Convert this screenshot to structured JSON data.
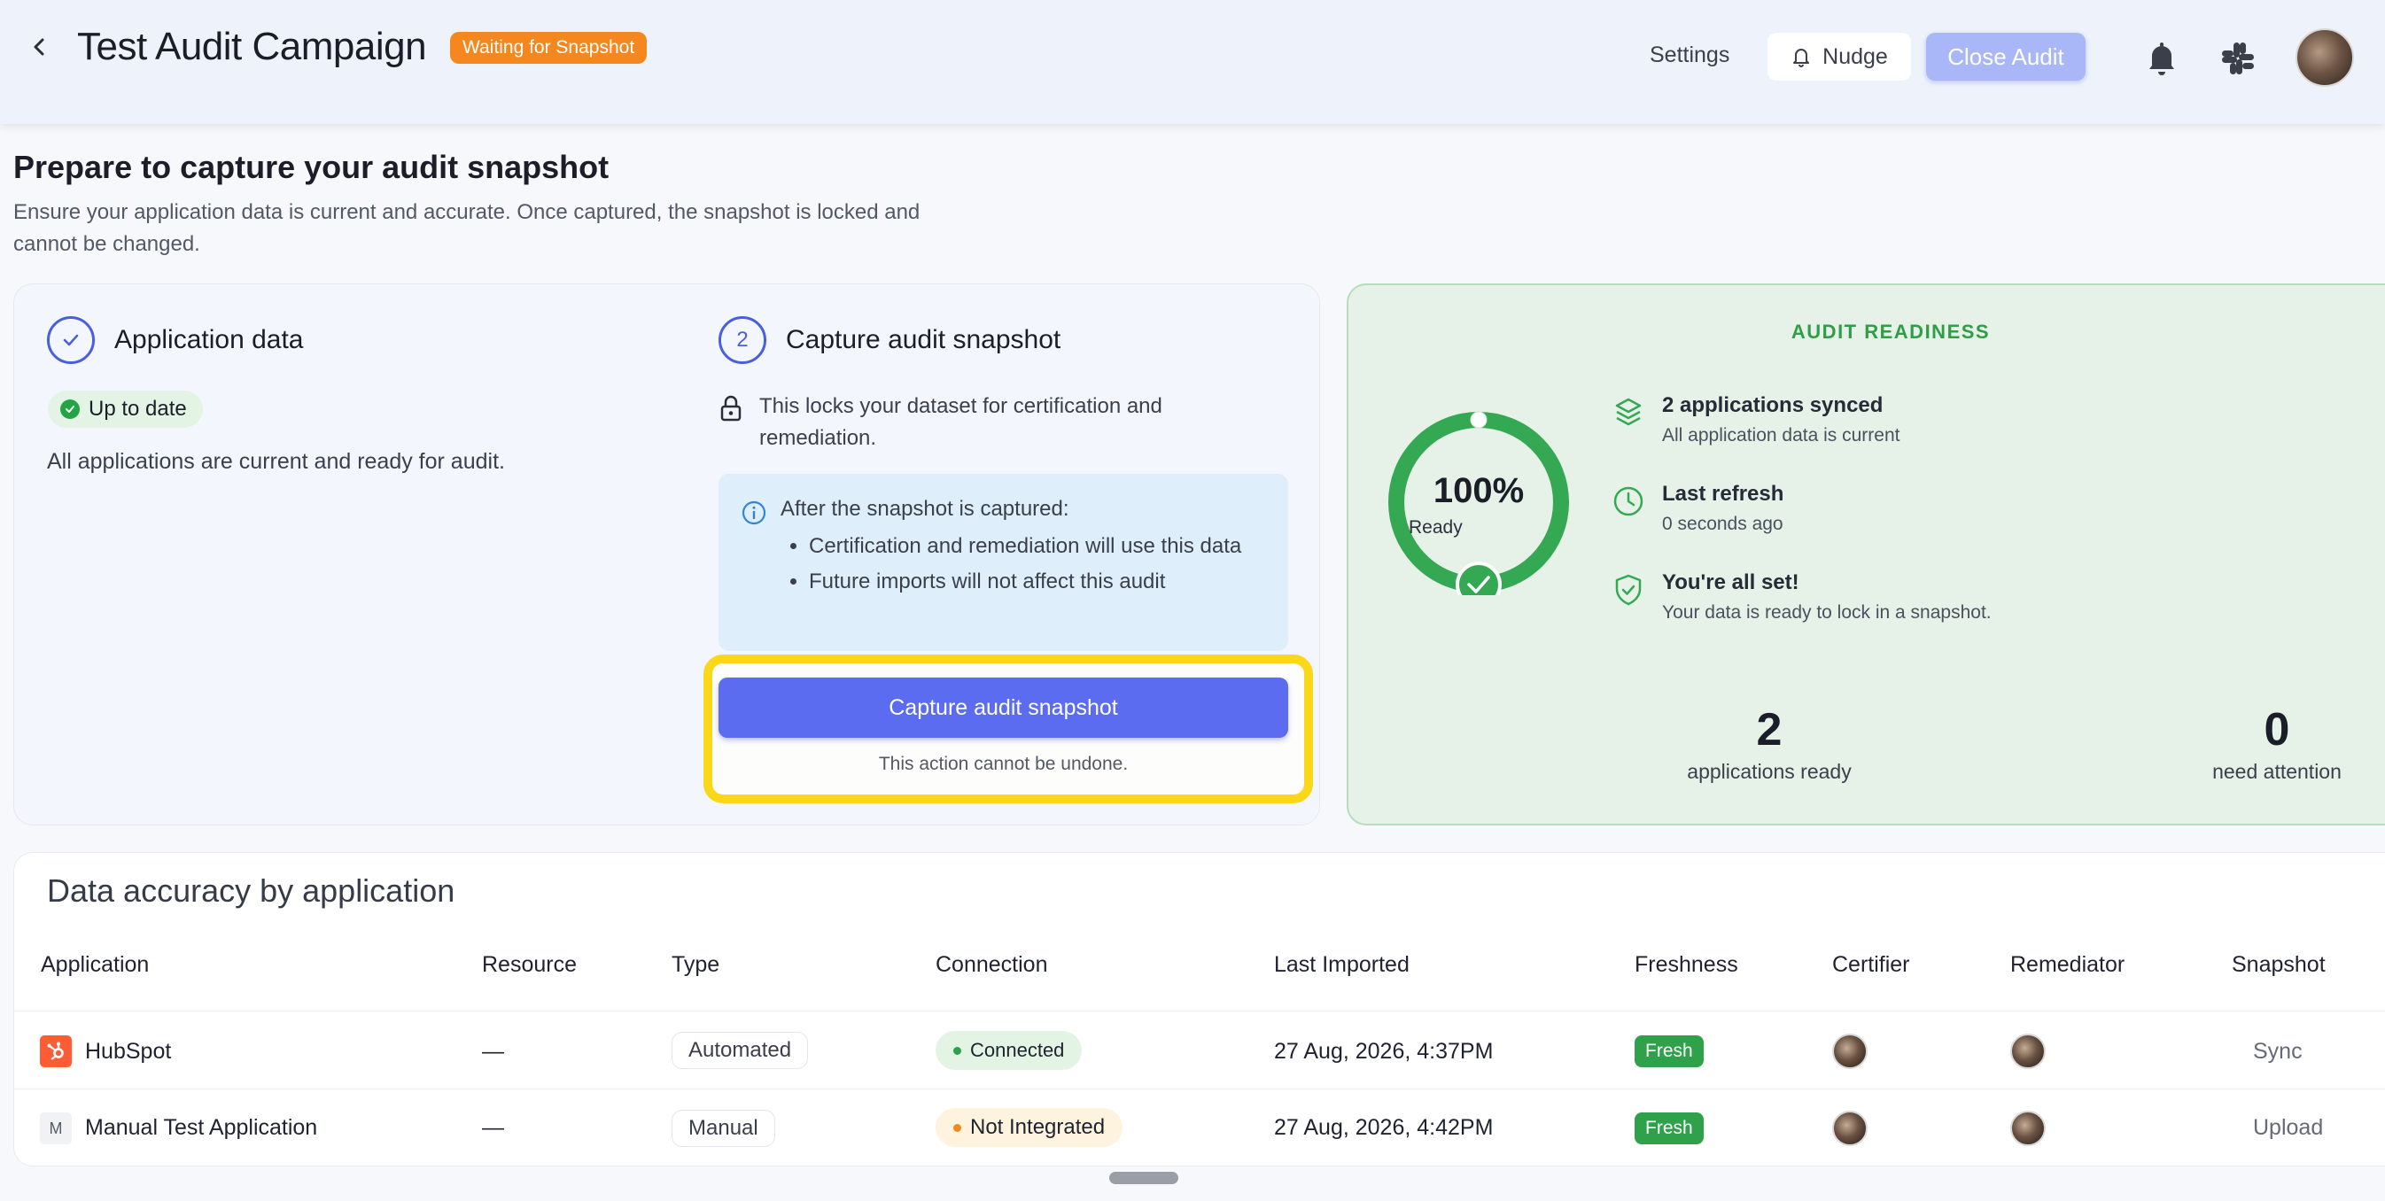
{
  "header": {
    "title": "Test Audit Campaign",
    "status_badge": "Waiting for Snapshot",
    "settings_label": "Settings",
    "nudge_label": "Nudge",
    "close_audit_label": "Close Audit"
  },
  "intro": {
    "heading": "Prepare to capture your audit snapshot",
    "description": "Ensure your application data is current and accurate. Once captured, the snapshot is locked and cannot be changed."
  },
  "step1": {
    "title": "Application data",
    "badge": "Up to date",
    "description": "All applications are current and ready for audit."
  },
  "step2": {
    "number": "2",
    "title": "Capture audit snapshot",
    "lock_text": "This locks your dataset for certification and remediation.",
    "info_title": "After the snapshot is captured:",
    "info_items": [
      "Certification and remediation will use this data",
      "Future imports will not affect this audit"
    ],
    "button_label": "Capture audit snapshot",
    "undo_note": "This action cannot be undone."
  },
  "readiness": {
    "heading": "AUDIT READINESS",
    "percent_text": "100%",
    "percent_value": 100,
    "ring_label": "Ready",
    "items": [
      {
        "icon": "layers-icon",
        "title": "2 applications synced",
        "subtitle": "All application data is current"
      },
      {
        "icon": "clock-icon",
        "title": "Last refresh",
        "subtitle": "0 seconds ago"
      },
      {
        "icon": "shield-check-icon",
        "title": "You're all set!",
        "subtitle": "Your data is ready to lock in a snapshot."
      }
    ],
    "stats": [
      {
        "value": "2",
        "label": "applications ready"
      },
      {
        "value": "0",
        "label": "need attention"
      }
    ]
  },
  "table": {
    "title": "Data accuracy by application",
    "columns": [
      "Application",
      "Resource",
      "Type",
      "Connection",
      "Last Imported",
      "Freshness",
      "Certifier",
      "Remediator",
      "Snapshot"
    ],
    "rows": [
      {
        "icon": "hubspot-icon",
        "application": "HubSpot",
        "resource": "—",
        "type": "Automated",
        "connection": "Connected",
        "last_imported": "27 Aug, 2026, 4:37PM",
        "freshness": "Fresh",
        "snapshot": "Sync"
      },
      {
        "icon": "manual-app-icon",
        "icon_letter": "M",
        "application": "Manual Test Application",
        "resource": "—",
        "type": "Manual",
        "connection": "Not Integrated",
        "last_imported": "27 Aug, 2026, 4:42PM",
        "freshness": "Fresh",
        "snapshot": "Upload"
      }
    ]
  },
  "colors": {
    "accent": "#5b6cf0",
    "status_orange": "#f4881e",
    "success_green": "#2fa14b",
    "highlight_yellow": "#fbd719",
    "connected_bg": "#e3f4e5",
    "not_integrated_bg": "#fdf3df"
  }
}
